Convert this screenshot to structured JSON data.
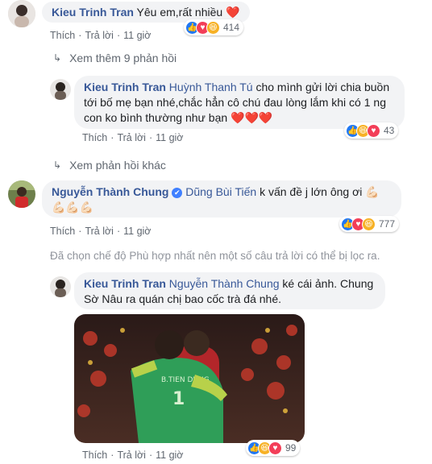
{
  "c1": {
    "name": "Kieu Trinh Tran",
    "text": "Yêu em,rất nhiều",
    "emoji": "❤️",
    "like": "Thích",
    "reply": "Trả lời",
    "time": "11 giờ",
    "reactions": "414"
  },
  "more1": "Xem thêm 9 phản hồi",
  "c2": {
    "name": "Kieu Trinh Tran",
    "tag": "Huỳnh Thanh Tú",
    "line1": "cho mình gửi lời chia buồn",
    "line2": "tới bố mẹ bạn nhé,chắc hẳn cô chú đau lòng lắm khi có 1 ng",
    "line3": "con ko bình thường như bạn",
    "emoji": "❤️❤️❤️",
    "like": "Thích",
    "reply": "Trả lời",
    "time": "11 giờ",
    "reactions": "43"
  },
  "more2": "Xem phản hồi khác",
  "c3": {
    "name": "Nguyễn Thành Chung",
    "verified": "✔",
    "tag": "Dũng Bùi Tiến",
    "text": "k vấn đề j lớn ông ơi",
    "emoji1": "💪🏻",
    "emoji2": "💪🏻💪🏻💪🏻",
    "like": "Thích",
    "reply": "Trả lời",
    "time": "11 giờ",
    "reactions": "777"
  },
  "notice": "Đã chọn chế độ Phù hợp nhất nên một số câu trả lời có thể bị lọc ra.",
  "c4": {
    "name": "Kieu Trinh Tran",
    "tag": "Nguyễn Thành Chung",
    "line1": "ké cái ảnh. Chung",
    "line2": "Sờ Nâu ra quán chị bao cốc trà đá nhé.",
    "jersey": "B.TIEN DUNG",
    "jersey_num": "1",
    "like": "Thích",
    "reply": "Trả lời",
    "time": "11 giờ",
    "reactions": "99"
  },
  "icons": {
    "like": "like-icon",
    "love": "love-icon",
    "haha": "haha-icon"
  }
}
